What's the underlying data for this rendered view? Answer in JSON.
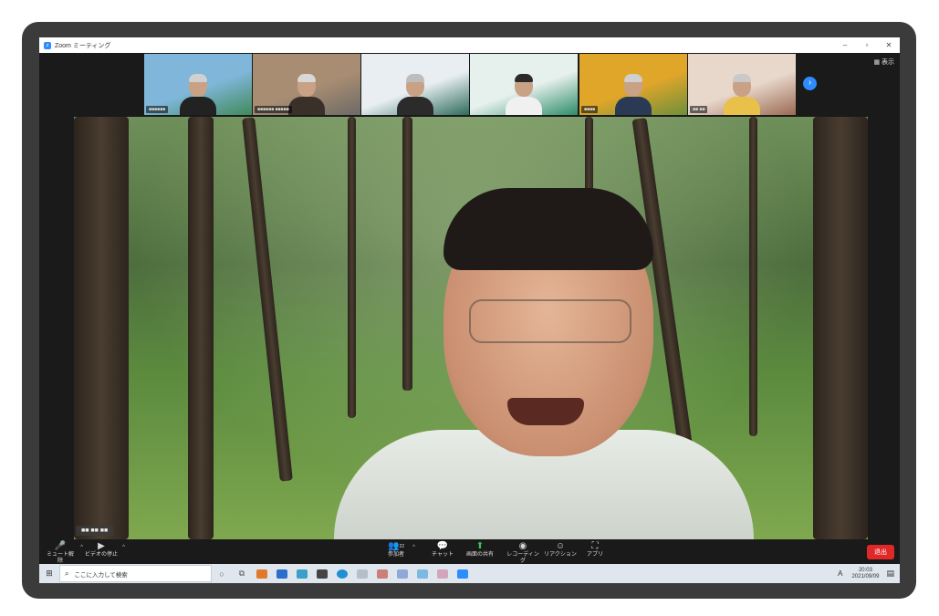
{
  "window": {
    "title": "Zoom ミーティング",
    "app_icon_letter": "z",
    "controls": [
      "–",
      "▫",
      "✕"
    ]
  },
  "gallery": {
    "view_label": "表示",
    "next_icon": "chevron-right-icon",
    "thumbnails": [
      {
        "name": "■■■■■■",
        "bg": "#7fb6d9",
        "accent": "#3f8a5a",
        "shirt": "#222222",
        "hair": "#d0d0d0"
      },
      {
        "name": "■■■■■■ ■■■■■",
        "bg": "#a88d72",
        "accent": "#6e6a66",
        "shirt": "#3a302a",
        "hair": "#d8d8d8"
      },
      {
        "name": "",
        "bg": "#e8eef2",
        "accent": "#2d6b5a",
        "shirt": "#2b2b2b",
        "hair": "#bdbdbd"
      },
      {
        "name": "",
        "bg": "#e6f0ec",
        "accent": "#2d8c6a",
        "shirt": "#f0f0f0",
        "hair": "#2a2a2a"
      },
      {
        "name": "■■■■",
        "bg": "#e0a62a",
        "accent": "#6f8f3a",
        "shirt": "#2a3a55",
        "hair": "#cfcfcf"
      },
      {
        "name": "■■ ■■",
        "bg": "#e8d8cc",
        "accent": "#9a6a52",
        "shirt": "#e8c04a",
        "hair": "#c9c9c9"
      }
    ]
  },
  "main": {
    "speaker_name": "■■ ■■ ■■"
  },
  "toolbar": {
    "mute_label": "ミュート解除",
    "video_label": "ビデオの停止",
    "participants_label": "参加者",
    "participants_count": "22",
    "chat_label": "チャット",
    "share_label": "画面の共有",
    "record_label": "レコーディング",
    "reaction_label": "リアクション",
    "apps_label": "アプリ",
    "leave_label": "退出"
  },
  "taskbar": {
    "search_placeholder": "ここに入力して検索",
    "ime": "A",
    "time": "20:03",
    "date": "2021/09/09"
  }
}
